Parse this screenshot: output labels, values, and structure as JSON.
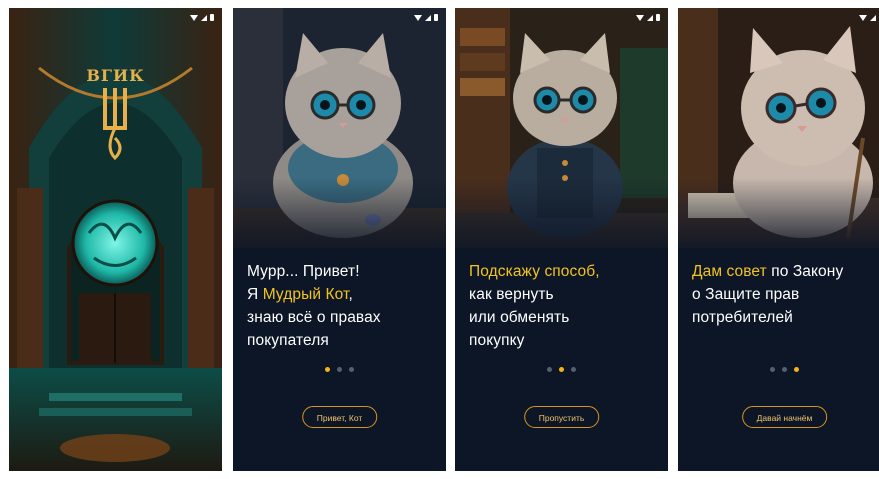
{
  "screens": [
    {
      "logo_text": "ВГИК"
    },
    {
      "lines": [
        [
          {
            "text": "Мурр... Привет!",
            "hl": false
          }
        ],
        [
          {
            "text": "Я ",
            "hl": false
          },
          {
            "text": "Мудрый Кот",
            "hl": true
          },
          {
            "text": ",",
            "hl": false
          }
        ],
        [
          {
            "text": "знаю всё о правах",
            "hl": false
          }
        ],
        [
          {
            "text": "покупателя",
            "hl": false
          }
        ]
      ],
      "active_dot": 0,
      "button": "Привет, Кот"
    },
    {
      "lines": [
        [
          {
            "text": "Подскажу способ,",
            "hl": true
          }
        ],
        [
          {
            "text": "как вернуть",
            "hl": false
          }
        ],
        [
          {
            "text": "или обменять",
            "hl": false
          }
        ],
        [
          {
            "text": "покупку",
            "hl": false
          }
        ]
      ],
      "active_dot": 1,
      "button": "Пропустить"
    },
    {
      "lines": [
        [
          {
            "text": "Дам совет",
            "hl": true
          },
          {
            "text": " по Закону",
            "hl": false
          }
        ],
        [
          {
            "text": "о Защите прав",
            "hl": false
          }
        ],
        [
          {
            "text": "потребителей",
            "hl": false
          }
        ]
      ],
      "active_dot": 2,
      "button": "Давай начнём"
    }
  ],
  "colors": {
    "accent": "#f3c320",
    "button_border": "#d8951e",
    "bg": "#0d1626"
  },
  "icons": [
    "wifi-icon",
    "signal-icon",
    "battery-icon"
  ]
}
